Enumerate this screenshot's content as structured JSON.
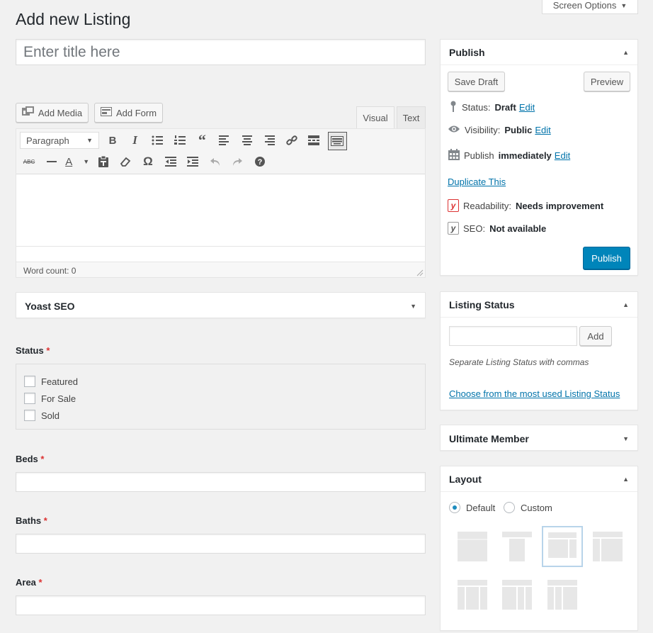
{
  "page": {
    "title": "Add new Listing",
    "screen_options": "Screen Options"
  },
  "title_input": {
    "placeholder": "Enter title here"
  },
  "editor": {
    "add_media": "Add Media",
    "add_form": "Add Form",
    "tab_visual": "Visual",
    "tab_text": "Text",
    "format_select": "Paragraph",
    "word_count": "Word count: 0",
    "toolbar_row1": [
      "bold-icon",
      "italic-icon",
      "bullet-list-icon",
      "numbered-list-icon",
      "blockquote-icon",
      "align-left-icon",
      "align-center-icon",
      "align-right-icon",
      "link-icon",
      "read-more-icon",
      "toolbar-toggle-icon"
    ],
    "toolbar_row2": [
      "strikethrough-icon",
      "horizontal-line-icon",
      "text-color-icon",
      "paste-text-icon",
      "clear-formatting-icon",
      "special-character-icon",
      "outdent-icon",
      "indent-icon",
      "undo-icon",
      "redo-icon",
      "help-icon"
    ]
  },
  "yoast_panel": {
    "title": "Yoast SEO"
  },
  "fields": {
    "status": {
      "label": "Status",
      "req": "*",
      "options": [
        "Featured",
        "For Sale",
        "Sold"
      ]
    },
    "beds": {
      "label": "Beds",
      "req": "*"
    },
    "baths": {
      "label": "Baths",
      "req": "*"
    },
    "area": {
      "label": "Area",
      "req": "*"
    }
  },
  "publish": {
    "title": "Publish",
    "save_draft": "Save Draft",
    "preview": "Preview",
    "status_label": "Status:",
    "status_value": "Draft",
    "status_edit": "Edit",
    "visibility_label": "Visibility:",
    "visibility_value": "Public",
    "visibility_edit": "Edit",
    "publish_label": "Publish",
    "publish_value": "immediately",
    "publish_edit": "Edit",
    "duplicate": "Duplicate This",
    "readability_label": "Readability:",
    "readability_value": "Needs improvement",
    "seo_label": "SEO:",
    "seo_value": "Not available",
    "publish_button": "Publish"
  },
  "listing_status": {
    "title": "Listing Status",
    "add": "Add",
    "hint": "Separate Listing Status with commas",
    "choose": "Choose from the most used Listing Status"
  },
  "ultimate_member": {
    "title": "Ultimate Member"
  },
  "layout": {
    "title": "Layout",
    "default": "Default",
    "custom": "Custom",
    "selected": "Default"
  },
  "colors": {
    "accent": "#0085ba",
    "link": "#0073aa",
    "required": "#dc3232",
    "readability_icon": "#dc3232"
  }
}
